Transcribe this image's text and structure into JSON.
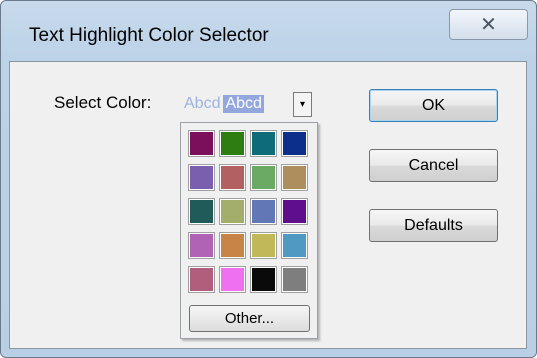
{
  "window": {
    "title": "Text Highlight Color Selector",
    "close_glyph": "✕"
  },
  "selector": {
    "label": "Select Color:",
    "preview_plain": "Abcd",
    "preview_highlight": "Abcd",
    "dropdown_glyph": "▾"
  },
  "palette": {
    "colors": [
      "#7c0f5c",
      "#2e7d10",
      "#0e6b78",
      "#0d2f8c",
      "#7a5fae",
      "#b26060",
      "#6aaa64",
      "#ad8e5c",
      "#205b5a",
      "#a2ae6a",
      "#6277b5",
      "#5f0f8c",
      "#b063b5",
      "#c88446",
      "#c1b857",
      "#4e9ac2",
      "#b05e7c",
      "#ef71f1",
      "#0a0a0a",
      "#7e7e7e"
    ],
    "other_label": "Other..."
  },
  "buttons": {
    "ok": "OK",
    "cancel": "Cancel",
    "defaults": "Defaults"
  }
}
